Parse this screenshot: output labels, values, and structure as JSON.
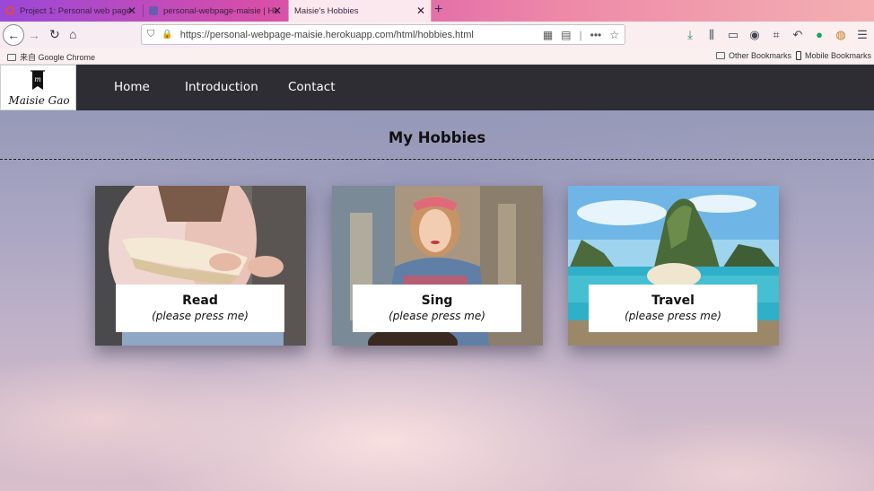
{
  "browser": {
    "tabs": [
      {
        "label": "Project 1: Personal web page",
        "active": false,
        "favicon_color": "#e24a3a"
      },
      {
        "label": "personal-webpage-maisie | He",
        "active": false,
        "favicon_color": "#6b5bb0"
      },
      {
        "label": "Maisie's Hobbies",
        "active": true,
        "favicon_color": ""
      }
    ],
    "url": "https://personal-webpage-maisie.herokuapp.com/html/hobbies.html",
    "bookmarks": {
      "left": "来自 Google Chrome",
      "other": "Other Bookmarks",
      "mobile": "Mobile Bookmarks"
    }
  },
  "site": {
    "logo_text": "Maisie Gao",
    "logo_mark": "m",
    "nav": [
      "Home",
      "Introduction",
      "Contact"
    ],
    "page_title": "My Hobbies",
    "cards": [
      {
        "title": "Read",
        "subtitle": "(please press me)",
        "image": "book-reading-photo"
      },
      {
        "title": "Sing",
        "subtitle": "(please press me)",
        "image": "singer-guitar-photo"
      },
      {
        "title": "Travel",
        "subtitle": "(please press me)",
        "image": "tropical-island-photo"
      }
    ]
  },
  "colors": {
    "header_bg": "#2e2d33",
    "tabbar_start": "#9a48d8",
    "tabbar_end": "#f3b0b2"
  }
}
